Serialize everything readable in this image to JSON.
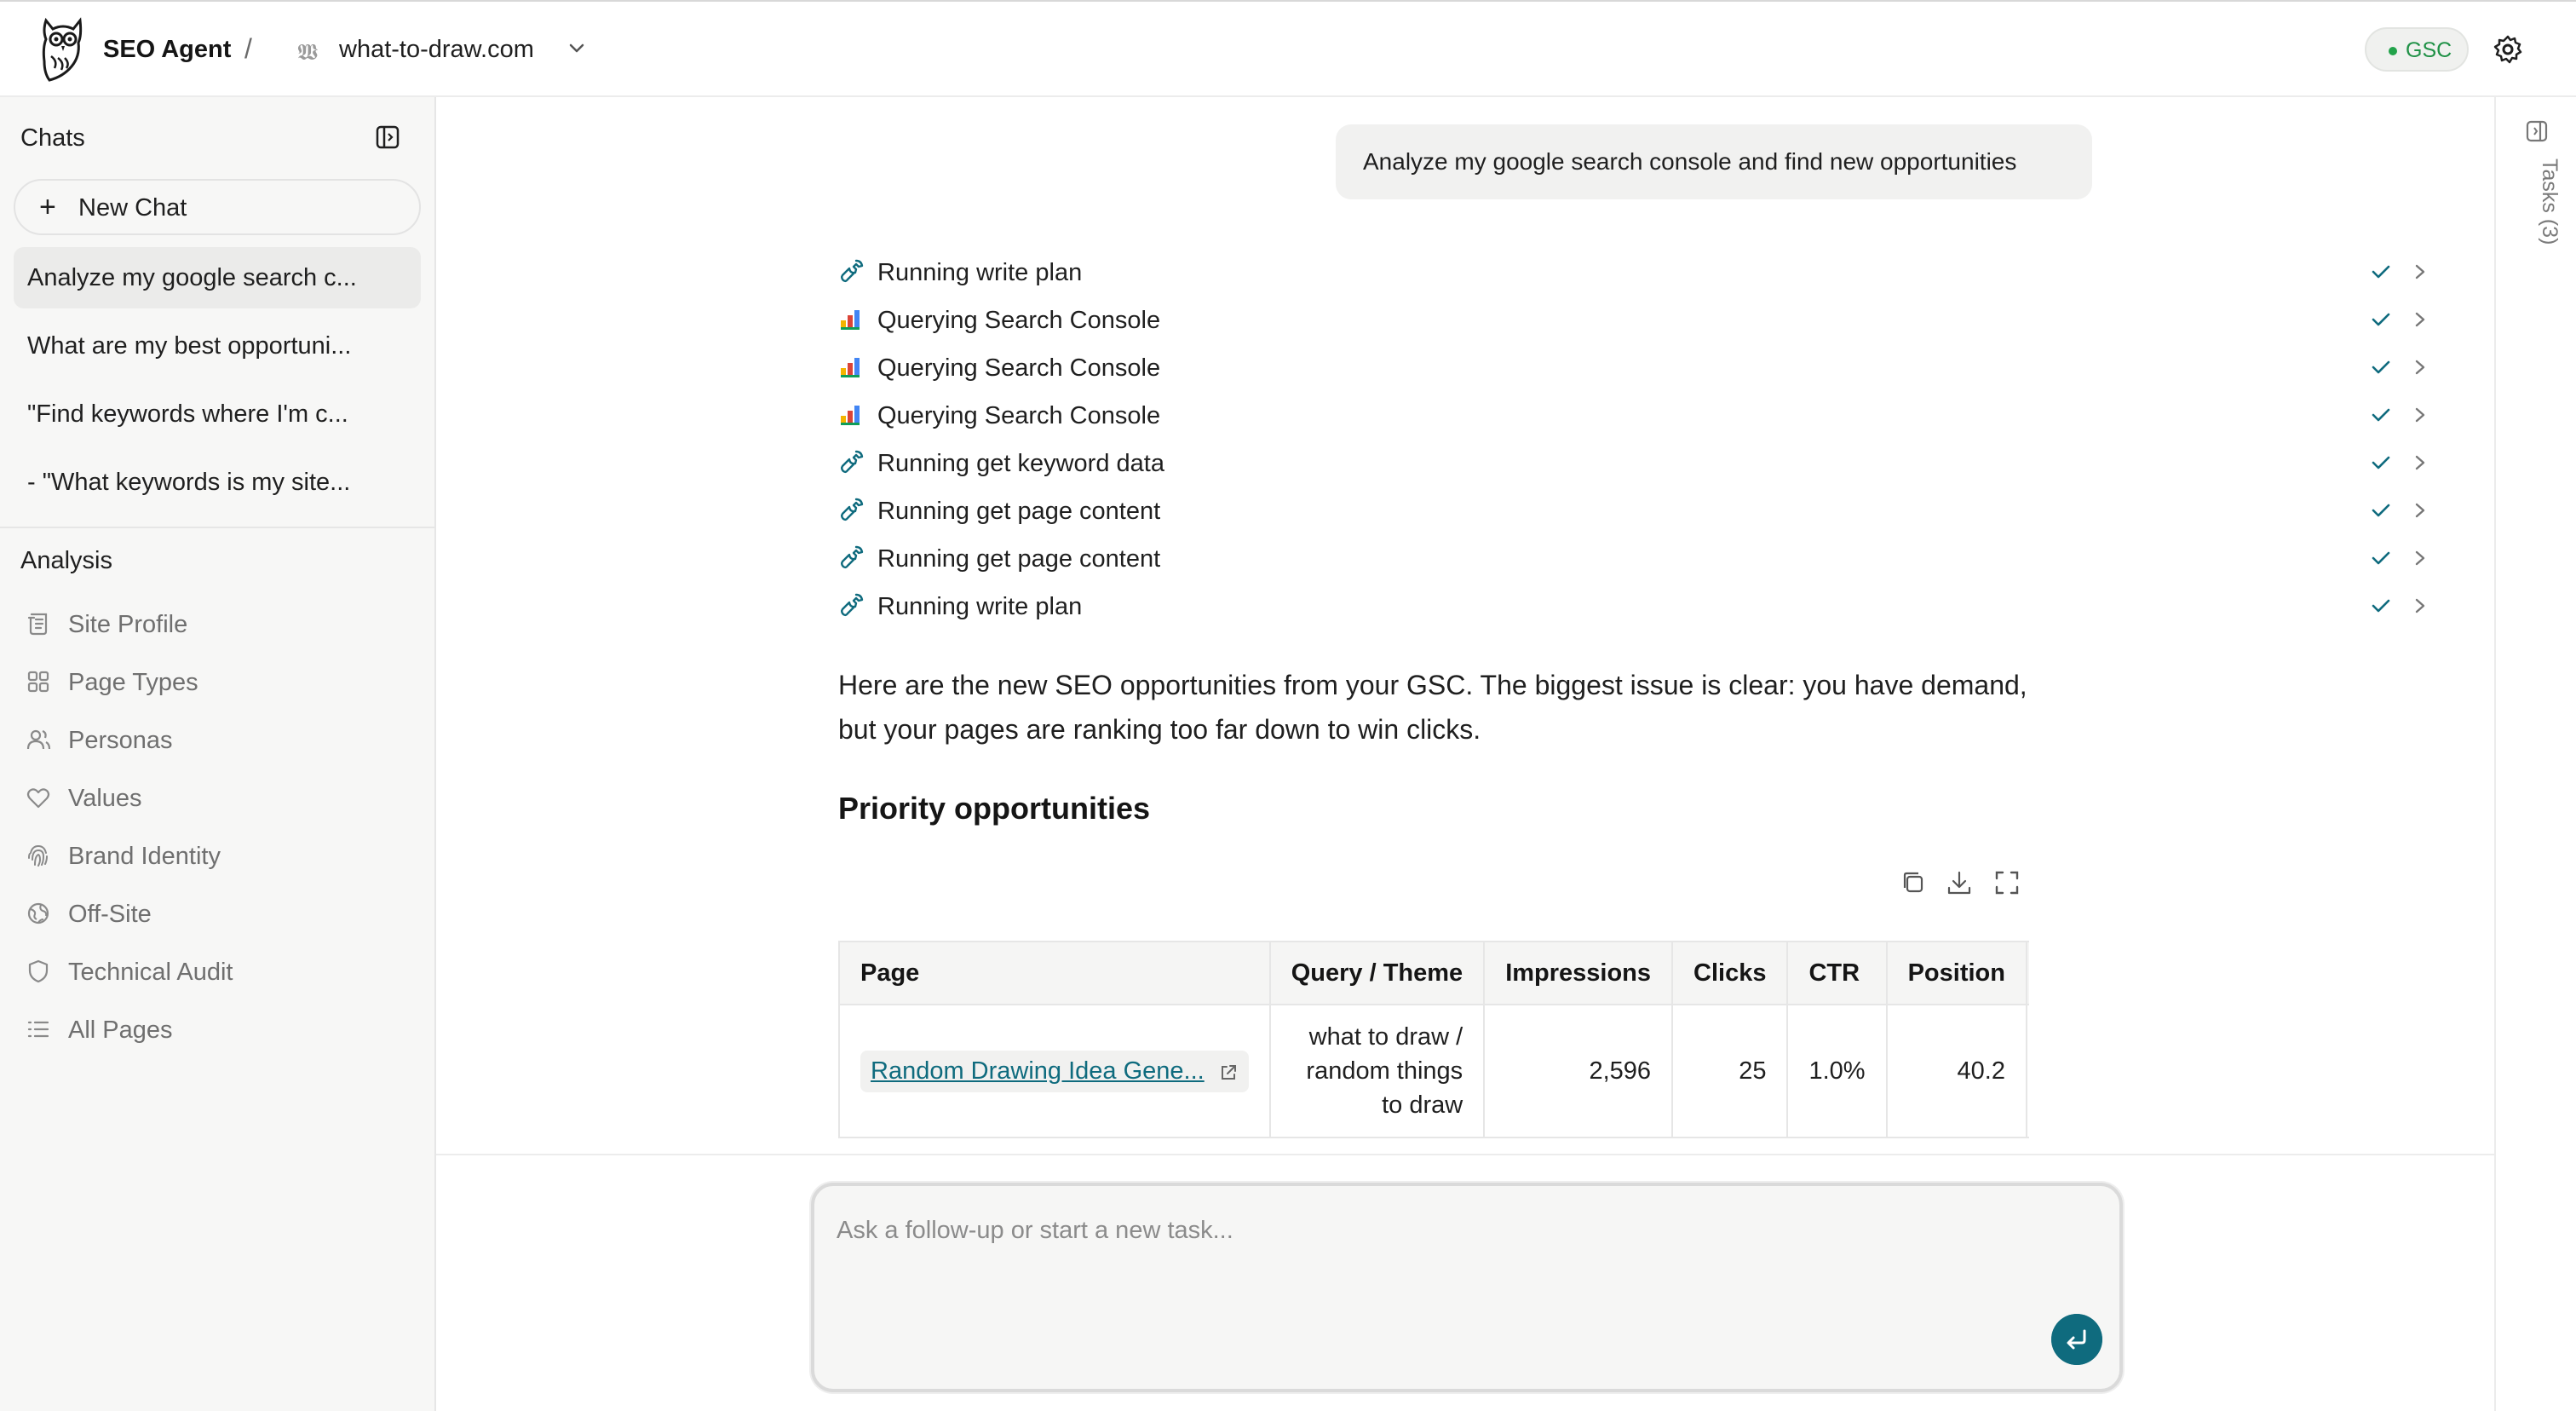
{
  "header": {
    "app_title": "SEO Agent",
    "separator": "/",
    "site_name": "what-to-draw.com",
    "gsc_badge": "GSC",
    "status_color": "#22a34a"
  },
  "sidebar": {
    "chats_title": "Chats",
    "new_chat_label": "New Chat",
    "chats": [
      {
        "label": "Analyze my google search c...",
        "active": true
      },
      {
        "label": "What are my best opportuni...",
        "active": false
      },
      {
        "label": "\"Find keywords where I'm c...",
        "active": false
      },
      {
        "label": "- \"What keywords is my site...",
        "active": false
      }
    ],
    "analysis_title": "Analysis",
    "analysis_items": [
      {
        "label": "Site Profile",
        "icon": "scroll-icon"
      },
      {
        "label": "Page Types",
        "icon": "grid-icon"
      },
      {
        "label": "Personas",
        "icon": "users-icon"
      },
      {
        "label": "Values",
        "icon": "heart-icon"
      },
      {
        "label": "Brand Identity",
        "icon": "fingerprint-icon"
      },
      {
        "label": "Off-Site",
        "icon": "globe-icon"
      },
      {
        "label": "Technical Audit",
        "icon": "shield-icon"
      },
      {
        "label": "All Pages",
        "icon": "list-icon"
      }
    ]
  },
  "conversation": {
    "user_message": "Analyze my google search console and find new opportunities",
    "tool_steps": [
      {
        "label": "Running write plan",
        "icon": "wrench-icon",
        "status": "done"
      },
      {
        "label": "Querying Search Console",
        "icon": "search-console-icon",
        "status": "done"
      },
      {
        "label": "Querying Search Console",
        "icon": "search-console-icon",
        "status": "done"
      },
      {
        "label": "Querying Search Console",
        "icon": "search-console-icon",
        "status": "done"
      },
      {
        "label": "Running get keyword data",
        "icon": "wrench-icon",
        "status": "done"
      },
      {
        "label": "Running get page content",
        "icon": "wrench-icon",
        "status": "done"
      },
      {
        "label": "Running get page content",
        "icon": "wrench-icon",
        "status": "done"
      },
      {
        "label": "Running write plan",
        "icon": "wrench-icon",
        "status": "done"
      }
    ],
    "answer_intro": "Here are the new SEO opportunities from your GSC. The biggest issue is clear: you have demand, but your pages are ranking too far down to win clicks.",
    "answer_heading": "Priority opportunities",
    "table": {
      "columns": [
        "Page",
        "Query / Theme",
        "Impressions",
        "Clicks",
        "CTR",
        "Position"
      ],
      "rows": [
        {
          "page": "Random Drawing Idea Gene...",
          "query": "what to draw / random things to draw",
          "impressions": "2,596",
          "clicks": "25",
          "ctr": "1.0%",
          "position": "40.2"
        }
      ]
    }
  },
  "composer": {
    "placeholder": "Ask a follow-up or start a new task...",
    "value": ""
  },
  "right_rail": {
    "tasks_label": "Tasks (3)"
  },
  "colors": {
    "accent": "#0f6b7e",
    "check": "#0f6b7e",
    "gsc_text": "#1f9146"
  }
}
